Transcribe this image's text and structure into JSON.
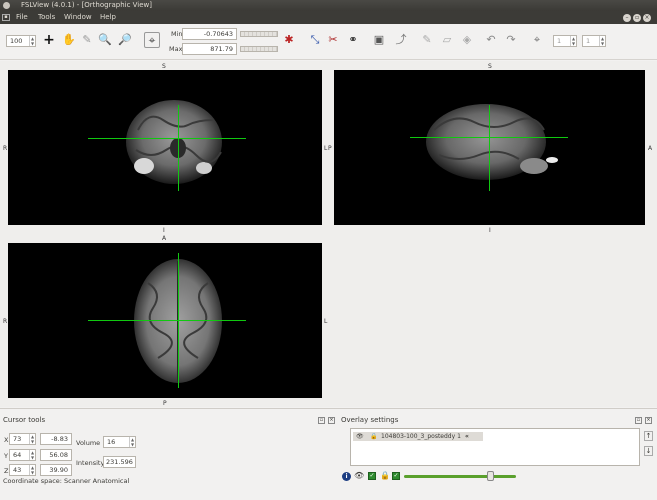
{
  "window": {
    "title": "FSLView (4.0.1) - [Orthographic View]"
  },
  "menu": [
    "File",
    "Tools",
    "Window",
    "Help"
  ],
  "toolbar": {
    "zoom_value": "100",
    "min_label": "Min",
    "min_value": "-0.70643",
    "max_label": "Max",
    "max_value": "871.79",
    "spin1_value": "1",
    "spin2_value": "1",
    "icons": [
      "crosshair-plus-icon",
      "hand-icon",
      "pencil-icon",
      "zoom-in-icon",
      "zoom-out-icon",
      "cursor-target-icon",
      "colorbar-icon",
      "axes-icon",
      "mask-icon",
      "binoculars-icon",
      "save-icon",
      "flip-icon",
      "draw-icon",
      "eraser-icon",
      "fill-icon",
      "undo-icon",
      "redo-icon",
      "crosshair-icon"
    ]
  },
  "views": {
    "coronal": {
      "top": "S",
      "bottom": "I",
      "left": "R",
      "right": "L"
    },
    "sagittal": {
      "top": "S",
      "bottom": "I",
      "left": "P",
      "right": "A"
    },
    "axial": {
      "top": "A",
      "bottom": "P",
      "left": "R",
      "right": "L"
    }
  },
  "cursor_tools": {
    "title": "Cursor tools",
    "x_label": "X",
    "x_voxel": "73",
    "x_mm": "-8.83",
    "y_label": "Y",
    "y_voxel": "64",
    "y_mm": "56.08",
    "z_label": "Z",
    "z_voxel": "43",
    "z_mm": "39.90",
    "volume_label": "Volume",
    "volume_value": "16",
    "intensity_label": "Intensity",
    "intensity_value": "231.596",
    "coord_space": "Coordinate space: Scanner Anatomical"
  },
  "overlay_settings": {
    "title": "Overlay settings",
    "layers": [
      "104803-100_3_posteddy 1"
    ],
    "opacity": 0.77
  },
  "colors": {
    "crosshair": "#10c810",
    "titlebar": "#3c3b37"
  }
}
